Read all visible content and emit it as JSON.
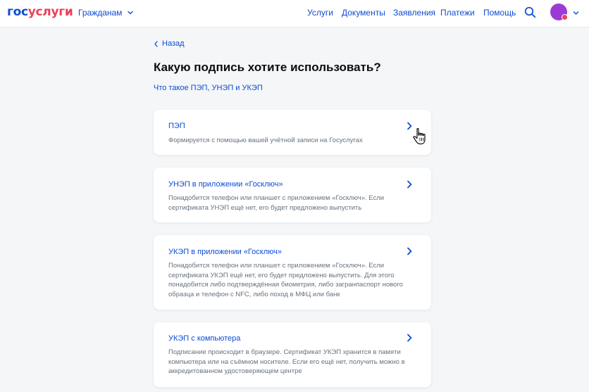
{
  "header": {
    "logo_part1": "гос",
    "logo_part2": "услуги",
    "audience_label": "Гражданам",
    "nav": [
      {
        "label": "Услуги"
      },
      {
        "label": "Документы"
      },
      {
        "label": "Заявления"
      },
      {
        "label": "Платежи"
      },
      {
        "label": "Помощь"
      }
    ],
    "icons": {
      "search": "search-icon",
      "avatar": "avatar",
      "chevron": "chevron-down-icon"
    },
    "colors": {
      "brand_blue": "#0d4cd3",
      "brand_red": "#ee3f58",
      "avatar": "#9b3bd6"
    }
  },
  "main": {
    "back_label": "Назад",
    "title": "Какую подпись хотите использовать?",
    "info_link": "Что такое ПЭП, УНЭП и УКЭП",
    "options": [
      {
        "title": "ПЭП",
        "description": "Формируется с помощью вашей учётной записи на Госуслугах"
      },
      {
        "title": "УНЭП в приложении «Госключ»",
        "description": "Понадобится телефон или планшет с приложением «Госключ». Если сертификата УНЭП ещё нет, его будет предложено выпустить"
      },
      {
        "title": "УКЭП в приложении «Госключ»",
        "description": "Понадобится телефон или планшет с приложением «Госключ». Если сертификата УКЭП ещё нет, его будет предложено выпустить. Для этого понадобится либо подтверждённая биометрия, либо загранпаспорт нового образца и телефон с NFC, либо поход в МФЦ или банк"
      },
      {
        "title": "УКЭП с компьютера",
        "description": "Подписание происходит в браузере. Сертификат УКЭП хранится в памяти компьютера или на съёмном носителе. Если его ещё нет, получить можно в аккредитованном удостоверяющем центре"
      }
    ]
  }
}
